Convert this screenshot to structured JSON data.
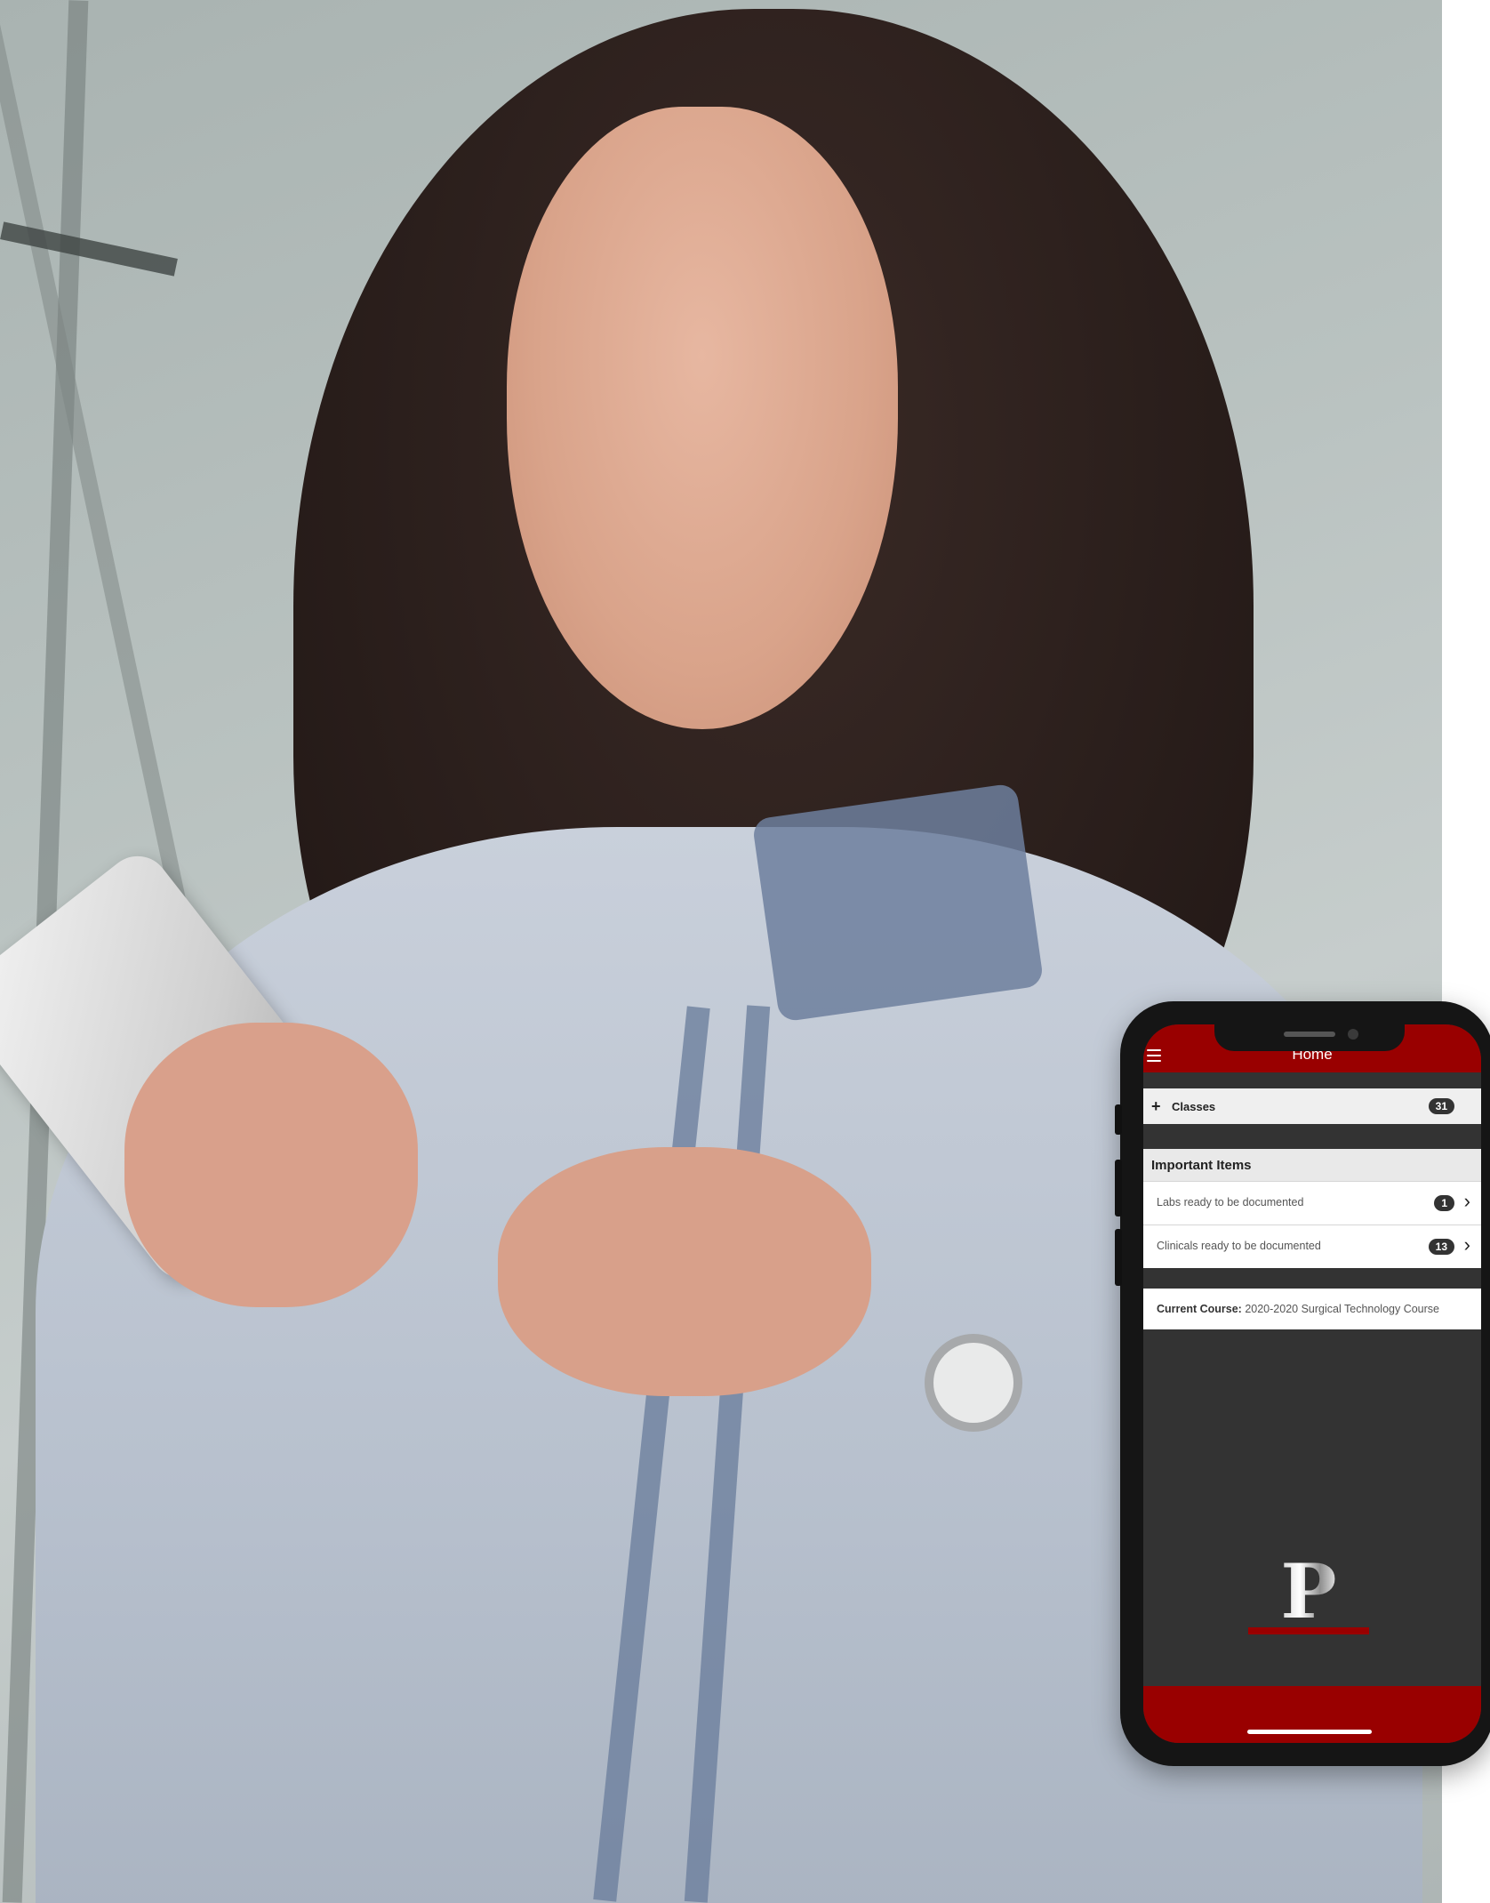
{
  "app": {
    "title": "Home"
  },
  "classes": {
    "expand_symbol": "+",
    "label": "Classes",
    "count": "31"
  },
  "important_items": {
    "heading": "Important Items",
    "items": [
      {
        "label": "Labs ready to be documented",
        "count": "1"
      },
      {
        "label": "Clinicals ready to be documented",
        "count": "13"
      }
    ]
  },
  "current_course": {
    "label": "Current Course:",
    "value": "2020-2020 Surgical Technology Course"
  },
  "branding": {
    "logo_letter": "P",
    "accent_color": "#990000"
  },
  "icons": {
    "menu": "hamburger-menu-icon",
    "chevron": "chevron-right-icon",
    "chevron_glyph": "›"
  }
}
